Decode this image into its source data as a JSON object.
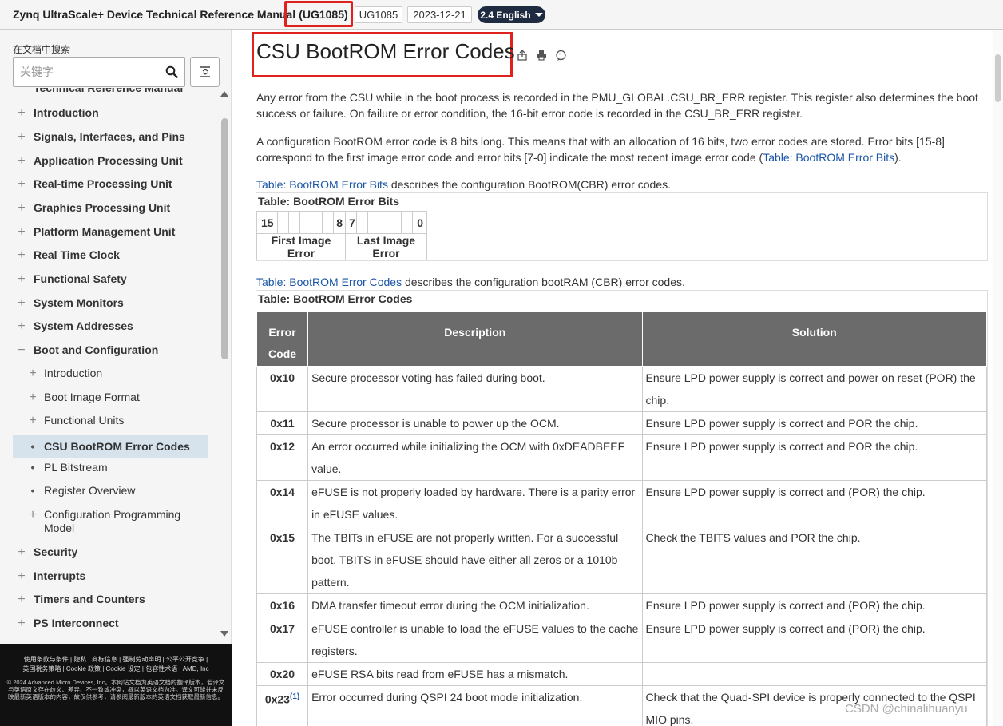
{
  "header": {
    "title": "Zynq UltraScale+ Device Technical Reference Manual",
    "doc_id": "(UG1085)",
    "pill_id": "UG1085",
    "pill_date": "2023-12-21",
    "language": "2.4 English",
    "highlight_color": "#e0221f"
  },
  "sidebar": {
    "search_label": "在文档中搜索",
    "search_placeholder": "关键字",
    "toc_top": "Technical Reference Manual",
    "items": [
      {
        "label": "Introduction",
        "level": 1,
        "sign": "+"
      },
      {
        "label": "Signals, Interfaces, and Pins",
        "level": 1,
        "sign": "+"
      },
      {
        "label": "Application Processing Unit",
        "level": 1,
        "sign": "+"
      },
      {
        "label": "Real-time Processing Unit",
        "level": 1,
        "sign": "+"
      },
      {
        "label": "Graphics Processing Unit",
        "level": 1,
        "sign": "+"
      },
      {
        "label": "Platform Management Unit",
        "level": 1,
        "sign": "+"
      },
      {
        "label": "Real Time Clock",
        "level": 1,
        "sign": "+"
      },
      {
        "label": "Functional Safety",
        "level": 1,
        "sign": "+"
      },
      {
        "label": "System Monitors",
        "level": 1,
        "sign": "+"
      },
      {
        "label": "System Addresses",
        "level": 1,
        "sign": "+"
      },
      {
        "label": "Boot and Configuration",
        "level": 1,
        "sign": "−"
      },
      {
        "label": "Introduction",
        "level": 2,
        "sign": "+"
      },
      {
        "label": "Boot Image Format",
        "level": 2,
        "sign": "+"
      },
      {
        "label": "Functional Units",
        "level": 2,
        "sign": "+"
      },
      {
        "label": "CSU BootROM Error Codes",
        "level": 2,
        "sign": "•"
      },
      {
        "label": "PL Bitstream",
        "level": 2,
        "sign": "•"
      },
      {
        "label": "Register Overview",
        "level": 2,
        "sign": "•"
      },
      {
        "label": "Configuration Programming Model",
        "level": 2,
        "sign": "+"
      },
      {
        "label": "Security",
        "level": 1,
        "sign": "+"
      },
      {
        "label": "Interrupts",
        "level": 1,
        "sign": "+"
      },
      {
        "label": "Timers and Counters",
        "level": 1,
        "sign": "+"
      },
      {
        "label": "PS Interconnect",
        "level": 1,
        "sign": "+"
      }
    ]
  },
  "footer": {
    "links1": "使用条款与条件 | 隐私 | 商标信息 | 强制劳动声明 | 公平公开竞争 |",
    "links2": "英国税务策略 | Cookie 政策 | Cookie 设定 | 包容性术语 | AMD, Inc",
    "legal": "© 2024 Advanced Micro Devices, Inc。本网站文档为英语文档的翻译版本，若译文与英语原文存在歧义、差异、不一致或冲突，概以英语文档为准。译文可能并未反映最新英语版本的内容，故仅供参考，请参阅最新版本的英语文档获取最新信息。"
  },
  "main": {
    "title": "CSU BootROM Error Codes",
    "para1": "Any error from the CSU while in the boot process is recorded in the PMU_GLOBAL.CSU_BR_ERR register. This register also determines the boot success or failure. On failure or error condition, the 16-bit error code is recorded in the CSU_BR_ERR register.",
    "para2a": "A configuration BootROM error code is 8 bits long. This means that with an allocation of 16 bits, two error codes are stored. Error bits [15-8] correspond to the first image error code and error bits [7-0] indicate the most recent image error code (",
    "para2_link": "Table: BootROM Error Bits",
    "para2b": ").",
    "para3_link": "Table: BootROM Error Bits",
    "para3_rest": " describes the configuration BootROM(CBR) error codes.",
    "bits_table": {
      "title": "Table: BootROM Error Bits",
      "hi_start": "15",
      "hi_end": "8",
      "lo_start": "7",
      "lo_end": "0",
      "first": "First Image Error",
      "last": "Last Image Error"
    },
    "para4_link": "Table: BootROM Error Codes",
    "para4_rest": " describes the configuration bootRAM (CBR) error codes.",
    "codes_table": {
      "title": "Table: BootROM Error Codes",
      "headers": [
        "Error Code",
        "Description",
        "Solution"
      ],
      "rows": [
        {
          "code": "0x10",
          "desc": "Secure processor voting has failed during boot.",
          "sol": "Ensure LPD power supply is correct and power on reset (POR) the chip."
        },
        {
          "code": "0x11",
          "desc": "Secure processor is unable to power up the OCM.",
          "sol": "Ensure LPD power supply is correct and POR the chip."
        },
        {
          "code": "0x12",
          "desc": "An error occurred while initializing the OCM with 0xDEADBEEF value.",
          "sol": "Ensure LPD power supply is correct and POR the chip."
        },
        {
          "code": "0x14",
          "desc": "eFUSE is not properly loaded by hardware. There is a parity error in eFUSE values.",
          "sol": "Ensure LPD power supply is correct and (POR) the chip."
        },
        {
          "code": "0x15",
          "desc": "The TBITs in eFUSE are not properly written. For a successful boot, TBITS in eFUSE should have either all zeros or a 1010b pattern.",
          "sol": "Check the TBITS values and POR the chip."
        },
        {
          "code": "0x16",
          "desc": "DMA transfer timeout error during the OCM initialization.",
          "sol": "Ensure LPD power supply is correct and (POR) the chip."
        },
        {
          "code": "0x17",
          "desc": "eFUSE controller is unable to load the eFUSE values to the cache registers.",
          "sol": "Ensure LPD power supply is correct and (POR) the chip."
        },
        {
          "code": "0x20",
          "desc": "eFUSE RSA bits read from eFUSE has a mismatch.",
          "sol": ""
        },
        {
          "code": "0x23",
          "sup": "(1)",
          "desc": "Error occurred during QSPI 24 boot mode initialization.",
          "sol": "Check that the Quad-SPI device is properly connected to the QSPI MIO pins."
        }
      ]
    }
  },
  "watermark": "CSDN @chinalihuanyu"
}
